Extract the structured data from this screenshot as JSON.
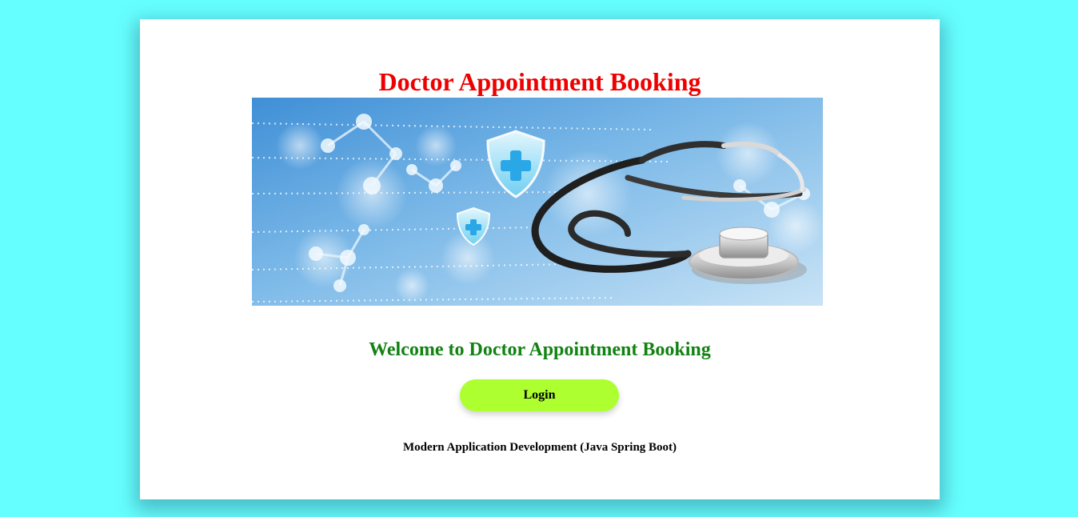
{
  "header": {
    "title": "Doctor Appointment Booking"
  },
  "banner": {
    "image": "stethoscope-medical-banner"
  },
  "main": {
    "welcome_text": "Welcome to Doctor Appointment Booking",
    "login_label": "Login"
  },
  "footer": {
    "course_text": "Modern Application Development (Java Spring Boot)"
  },
  "colors": {
    "page_background": "#66ffff",
    "card_background": "#ffffff",
    "title": "#ee0000",
    "welcome": "#128212",
    "login_button": "#adff2f"
  }
}
